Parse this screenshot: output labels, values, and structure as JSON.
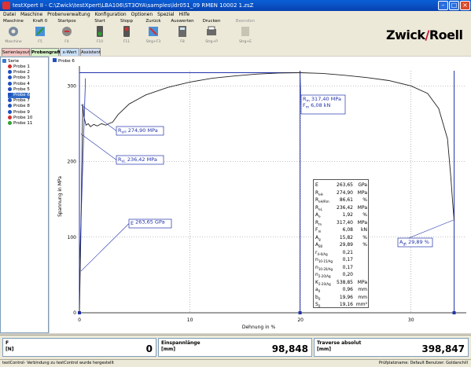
{
  "window": {
    "title": "testXpert II - C:\\Zwick\\testXpert\\LBA106\\ST3OYA\\samples\\ldr051_09 RMEN 10002 1.zsZ"
  },
  "menu": [
    "Datei",
    "Maschine",
    "Probenverwaltung",
    "Konfiguration",
    "Optionen",
    "Spezial",
    "Hilfe"
  ],
  "toolbar": [
    {
      "label": "Maschine",
      "shortcut": "Maschine",
      "icon": "gear-icon",
      "enabled": true
    },
    {
      "label": "Kraft 0",
      "shortcut": "F5",
      "icon": "force-zero-icon",
      "enabled": true
    },
    {
      "label": "Startpos",
      "shortcut": "F4",
      "icon": "start-position-icon",
      "enabled": true
    },
    {
      "label": "Start",
      "shortcut": "F10",
      "icon": "start-icon",
      "enabled": true
    },
    {
      "label": "Stopp",
      "shortcut": "F11",
      "icon": "stop-icon",
      "enabled": true
    },
    {
      "label": "Zurück",
      "shortcut": "Strg+F3",
      "icon": "return-icon",
      "enabled": true
    },
    {
      "label": "Auswerten",
      "shortcut": "F8",
      "icon": "evaluate-icon",
      "enabled": true
    },
    {
      "label": "Drucken",
      "shortcut": "Strg+P",
      "icon": "print-icon",
      "enabled": true
    },
    {
      "label": "Beenden",
      "shortcut": "Strg+E",
      "icon": "finish-icon",
      "enabled": false
    }
  ],
  "logo": {
    "left": "Zwick",
    "slash": "/",
    "right": "Roell"
  },
  "tabs": [
    {
      "label": "Serienlayout",
      "color": "#f4c7c3"
    },
    {
      "label": "Probengrafik",
      "color": "#d6f0c8",
      "active": true
    },
    {
      "label": "x-Wert",
      "color": "#c9e1f7"
    },
    {
      "label": "Assistent",
      "color": "#d2dcef"
    }
  ],
  "tree": {
    "root": "Serie",
    "items": [
      {
        "label": "Probe 1",
        "color": "#d03030"
      },
      {
        "label": "Probe 2",
        "color": "#2050c0"
      },
      {
        "label": "Probe 3",
        "color": "#2050c0"
      },
      {
        "label": "Probe 4",
        "color": "#2050c0"
      },
      {
        "label": "Probe 5",
        "color": "#2050c0"
      },
      {
        "label": "Probe 6",
        "color": "#2050c0",
        "selected": true
      },
      {
        "label": "Probe 7",
        "color": "#2050c0"
      },
      {
        "label": "Probe 8",
        "color": "#2050c0"
      },
      {
        "label": "Probe 9",
        "color": "#2050c0"
      },
      {
        "label": "Probe 10",
        "color": "#d03030"
      },
      {
        "label": "Probe 11",
        "color": "#30a030"
      }
    ]
  },
  "chart_header": "Probe 6",
  "chart_data": {
    "type": "line",
    "title": "Probe 6",
    "xlabel": "Dehnung in %",
    "ylabel": "Spannung in MPa",
    "xlim": [
      0,
      35
    ],
    "ylim": [
      0,
      320
    ],
    "x_ticks": [
      0,
      10,
      20,
      30
    ],
    "y_ticks": [
      0,
      100,
      200,
      300
    ],
    "series": [
      {
        "x": [
          0,
          0.15,
          0.25,
          0.3,
          0.4,
          0.6,
          0.8,
          1.0,
          1.3,
          1.6,
          2.0,
          2.4,
          2.8,
          3.0,
          3.5,
          4.5,
          6,
          8,
          10,
          12,
          14,
          16,
          18,
          19.96,
          22,
          24,
          26,
          28,
          30,
          31.5,
          32.5,
          33.3,
          33.6,
          33.8,
          33.9
        ],
        "y": [
          0,
          120,
          230,
          276,
          260,
          248,
          250,
          246,
          249,
          247,
          250,
          248,
          251,
          252,
          262,
          276,
          288,
          298,
          305,
          310,
          313,
          315.5,
          317,
          317.4,
          316.5,
          314,
          311,
          307,
          300,
          290,
          270,
          230,
          180,
          140,
          123
        ]
      }
    ],
    "annotations": [
      {
        "label": "Rm 317,40 MPa",
        "value": 317.4
      },
      {
        "label": "Fm 6,08 kN",
        "value": 6.08
      },
      {
        "label": "ReH 274,90 MPa",
        "value": 274.9
      },
      {
        "label": "ReL 236,42 MPa",
        "value": 236.42
      },
      {
        "label": "E 263,65 GPa",
        "value": 263.65
      },
      {
        "label": "Agt 29,89 %",
        "value": 29.89
      }
    ],
    "vertical_markers_x": [
      0,
      19.96,
      33.9
    ],
    "grid": true
  },
  "labels": {
    "rm": "317,40 MPa",
    "fm": "6,08 kN",
    "reh": "274,90 MPa",
    "rel": "236,42 MPa",
    "e": "263,65 GPa",
    "agt": "29,89 %"
  },
  "results_table": [
    {
      "sym": "E",
      "sub": "",
      "val": "263,65",
      "unit": "GPa"
    },
    {
      "sym": "R",
      "sub": "eH",
      "val": "274,90",
      "unit": "MPa"
    },
    {
      "sym": "R",
      "sub": "eH/Rm",
      "val": "86,61",
      "unit": "%"
    },
    {
      "sym": "R",
      "sub": "eL",
      "val": "236,42",
      "unit": "MPa"
    },
    {
      "sym": "A",
      "sub": "e",
      "val": "1,92",
      "unit": "%"
    },
    {
      "sym": "R",
      "sub": "m",
      "val": "317,40",
      "unit": "MPa"
    },
    {
      "sym": "F",
      "sub": "m",
      "val": "6,08",
      "unit": "kN"
    },
    {
      "sym": "A",
      "sub": "g",
      "val": "15,82",
      "unit": "%"
    },
    {
      "sym": "A",
      "sub": "80",
      "val": "29,89",
      "unit": "%"
    },
    {
      "sym": "r",
      "sub": "4-6/Ag",
      "val": "0,21",
      "unit": ""
    },
    {
      "sym": "n",
      "sub": "10-15/Ag",
      "val": "0,17",
      "unit": ""
    },
    {
      "sym": "n",
      "sub": "10-20/Ag",
      "val": "0,17",
      "unit": ""
    },
    {
      "sym": "n",
      "sub": "2-20/Ag",
      "val": "0,20",
      "unit": ""
    },
    {
      "sym": "K",
      "sub": "2-20/Ag",
      "val": "538,85",
      "unit": "MPa"
    },
    {
      "sym": "a",
      "sub": "0",
      "val": "0,96",
      "unit": "mm"
    },
    {
      "sym": "b",
      "sub": "0",
      "val": "19,96",
      "unit": "mm"
    },
    {
      "sym": "S",
      "sub": "0",
      "val": "19,16",
      "unit": "mm²"
    }
  ],
  "bottom_panels": [
    {
      "label": "F",
      "unit": "[N]",
      "value": "0"
    },
    {
      "label": "Einspannlänge",
      "unit": "[mm]",
      "value": "98,848"
    },
    {
      "label": "Traverse absolut",
      "unit": "[mm]",
      "value": "398,847"
    }
  ],
  "status": {
    "left": "testControl- Verbindung zu testControl wurde hergestellt",
    "right": "Prüfplatzname: Default  Benutzer: Goldanchill"
  }
}
